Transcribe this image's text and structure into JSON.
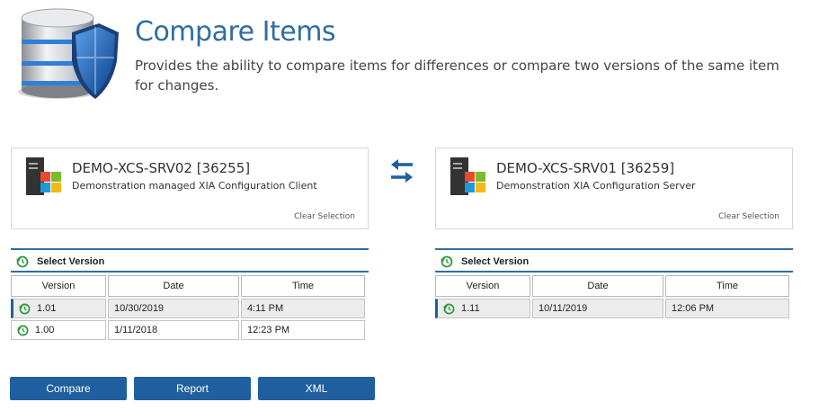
{
  "header": {
    "title": "Compare Items",
    "description": "Provides the ability to compare items for differences or compare two versions of the same item for changes.",
    "icon": "database-shield-icon"
  },
  "left_item": {
    "name": "DEMO-XCS-SRV02 [36255]",
    "description": "Demonstration managed XIA Configuration Client",
    "clear_label": "Clear Selection",
    "icon": "windows-server-icon"
  },
  "right_item": {
    "name": "DEMO-XCS-SRV01 [36259]",
    "description": "Demonstration XIA Configuration Server",
    "clear_label": "Clear Selection",
    "icon": "windows-server-icon"
  },
  "swap": {
    "icon": "swap-arrows-icon"
  },
  "left_versions": {
    "title": "Select Version",
    "columns": [
      "Version",
      "Date",
      "Time"
    ],
    "rows": [
      {
        "version": "1.01",
        "date": "10/30/2019",
        "time": "4:11 PM",
        "selected": true
      },
      {
        "version": "1.00",
        "date": "1/11/2018",
        "time": "12:23 PM",
        "selected": false
      }
    ]
  },
  "right_versions": {
    "title": "Select Version",
    "columns": [
      "Version",
      "Date",
      "Time"
    ],
    "rows": [
      {
        "version": "1.11",
        "date": "10/11/2019",
        "time": "12:06 PM",
        "selected": true
      }
    ]
  },
  "actions": {
    "compare": "Compare",
    "report": "Report",
    "xml": "XML"
  },
  "colors": {
    "accent": "#1f5fa0",
    "title": "#2f6e9e",
    "version_icon": "#2e9a3e"
  }
}
